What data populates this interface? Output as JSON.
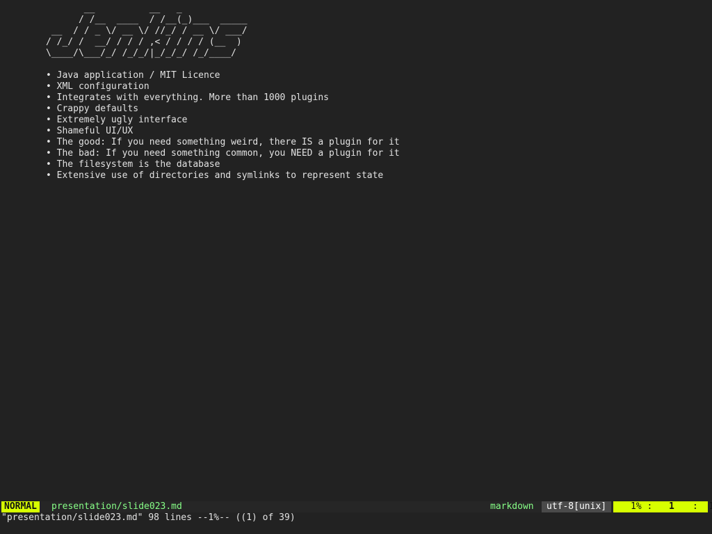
{
  "editor": {
    "ascii_art": [
      "       __          __   _",
      "      / /__  ____  / /__(_)___  _____",
      " __  / / _ \\/ __ \\/ //_/ / __ \\/ ___/",
      "/ /_/ /  __/ / / / ,< / / / / (__  )",
      "\\____/\\___/_/ /_/_/|_/_/_/ /_/____/"
    ],
    "bullet_symbol": "•",
    "bullets": [
      "Java application / MIT Licence",
      "XML configuration",
      "Integrates with everything. More than 1000 plugins",
      "Crappy defaults",
      "Extremely ugly interface",
      "Shameful UI/UX",
      "The good: If you need something weird, there IS a plugin for it",
      "The bad: If you need something common, you NEED a plugin for it",
      "The filesystem is the database",
      "Extensive use of directories and symlinks to represent state"
    ]
  },
  "statusline": {
    "mode": "NORMAL",
    "filename": "presentation/slide023.md",
    "filetype": "markdown",
    "encoding": "utf-8[unix]",
    "percent": "1% :",
    "line": "1",
    "column": ":  1"
  },
  "cmdline": {
    "message": "\"presentation/slide023.md\" 98 lines --1%-- ((1) of 39)"
  },
  "colors": {
    "background": "#222222",
    "mode_accent": "#d7ff00",
    "filename": "#87ff87",
    "encoding_bg": "#4a4a4a"
  }
}
